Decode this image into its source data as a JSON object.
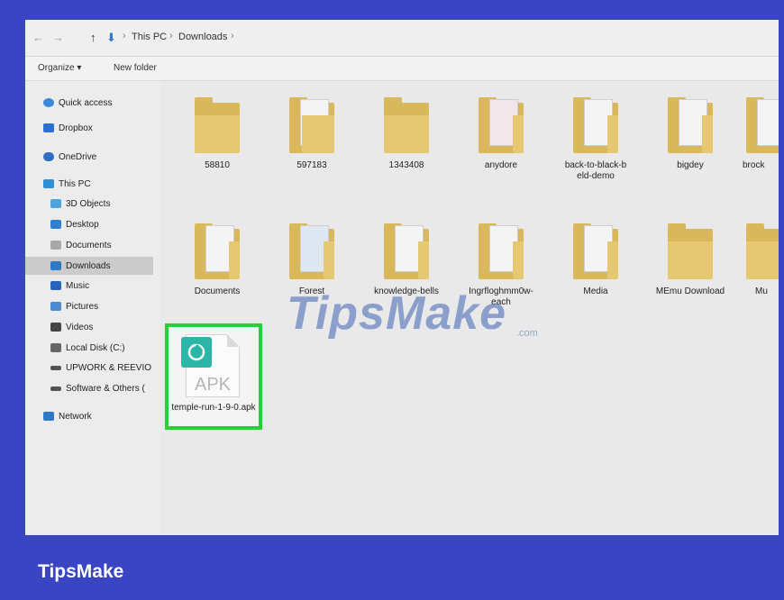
{
  "address_bar": {
    "back": "←",
    "forward": "→",
    "up": "↑",
    "crumbs": [
      "This PC",
      "Downloads"
    ],
    "separator": "›"
  },
  "command_bar": {
    "organize": "Organize ▾",
    "new_folder": "New folder"
  },
  "sidebar": {
    "items": [
      {
        "label": "Quick access",
        "icon": "star-icon",
        "color": "#3a88d8"
      },
      {
        "label": "Dropbox",
        "icon": "dropbox-icon",
        "color": "#2d6fd1"
      },
      {
        "label": "OneDrive",
        "icon": "cloud-icon",
        "color": "#2e6ec4"
      },
      {
        "label": "This PC",
        "icon": "computer-icon",
        "color": "#2f8fd7"
      },
      {
        "label": "3D Objects",
        "icon": "cube-icon",
        "color": "#4ea3dc"
      },
      {
        "label": "Desktop",
        "icon": "desktop-icon",
        "color": "#2f7fd0"
      },
      {
        "label": "Documents",
        "icon": "document-icon",
        "color": "#a8a8a8"
      },
      {
        "label": "Downloads",
        "icon": "download-icon",
        "color": "#2f78c8"
      },
      {
        "label": "Music",
        "icon": "music-icon",
        "color": "#2a64b8"
      },
      {
        "label": "Pictures",
        "icon": "picture-icon",
        "color": "#4a8ad0"
      },
      {
        "label": "Videos",
        "icon": "video-icon",
        "color": "#444444"
      },
      {
        "label": "Local Disk (C:)",
        "icon": "disk-icon",
        "color": "#666666"
      },
      {
        "label": "UPWORK & REEVIO",
        "icon": "drive-icon",
        "color": "#555555"
      },
      {
        "label": "Software & Others (",
        "icon": "drive-icon",
        "color": "#555555"
      },
      {
        "label": "Network",
        "icon": "network-icon",
        "color": "#2e78c8"
      }
    ],
    "selected": "Downloads"
  },
  "files_row1": [
    "58810",
    "597183",
    "1343408",
    "anydore",
    "back-to-black-b eld-demo",
    "bigdey",
    "brock"
  ],
  "files_row2": [
    "Documents",
    "Forest",
    "knowledge-bells",
    "Ingrfloghmm0w-each",
    "Media",
    "MEmu Download",
    "Mu"
  ],
  "apk_file": {
    "type_label": "APK",
    "name": "temple-run-1-9-0.apk"
  },
  "watermark": {
    "text": "TipsMake",
    "suffix": ".com"
  },
  "brand": "TipsMake",
  "colors": {
    "frame": "#3a45c4",
    "highlight": "#22d334",
    "apk_badge": "#2bb6a6"
  }
}
